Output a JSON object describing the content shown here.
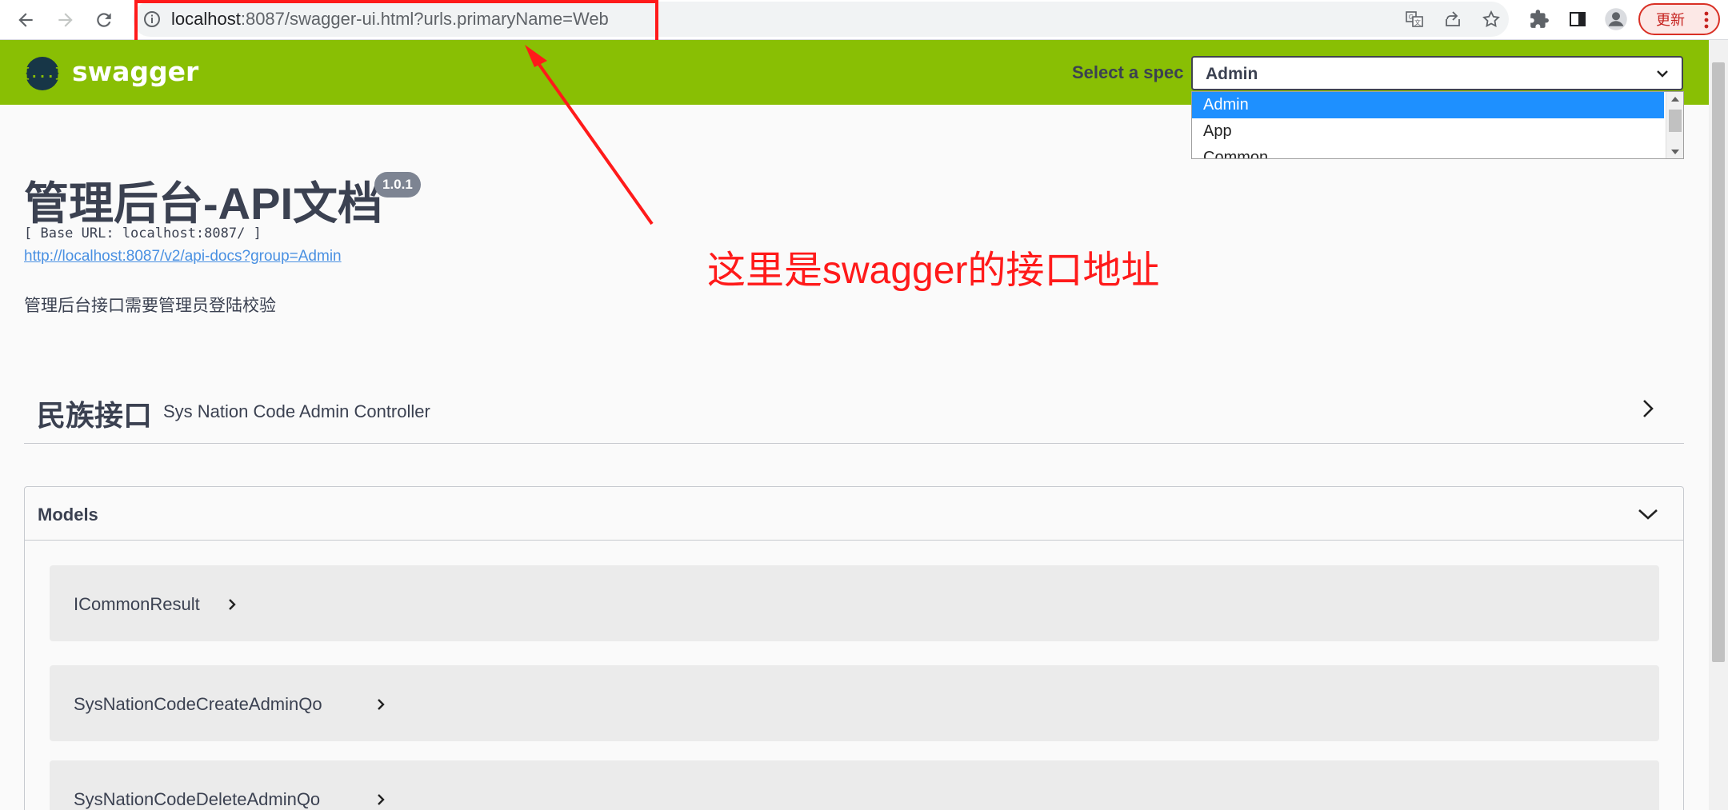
{
  "browser": {
    "url_host": "localhost",
    "url_rest": ":8087/swagger-ui.html?urls.primaryName=Web",
    "update_label": "更新"
  },
  "topbar": {
    "brand": "swagger",
    "logo_text": "{...}",
    "select_label": "Select a spec",
    "selected_spec": "Admin",
    "spec_options": [
      "Admin",
      "App",
      "Common"
    ]
  },
  "info": {
    "title": "管理后台-API文档",
    "version": "1.0.1",
    "base_url": "[ Base URL: localhost:8087/ ]",
    "docs_link": "http://localhost:8087/v2/api-docs?group=Admin",
    "description": "管理后台接口需要管理员登陆校验"
  },
  "annotation": {
    "text": "这里是swagger的接口地址"
  },
  "tag": {
    "name": "民族接口",
    "description": "Sys Nation Code Admin Controller"
  },
  "models": {
    "title": "Models",
    "items": [
      "ICommonResult",
      "SysNationCodeCreateAdminQo",
      "SysNationCodeDeleteAdminQo"
    ]
  },
  "colors": {
    "swagger_green": "#89bf04",
    "annotation_red": "#ff1a1a",
    "selected_option": "#1e90ff"
  }
}
